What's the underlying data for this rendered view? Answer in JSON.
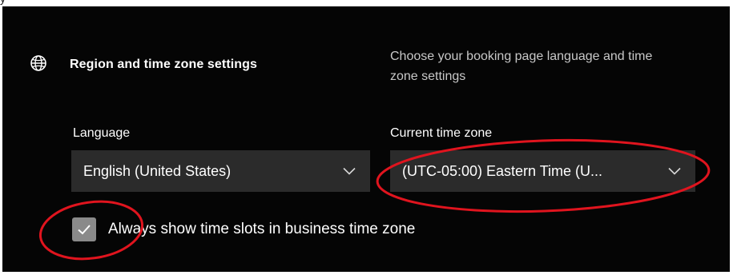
{
  "partial_top_text": "y",
  "section": {
    "icon": "globe-icon",
    "title": "Region and time zone settings",
    "description": "Choose your booking page language and time zone settings"
  },
  "language": {
    "label": "Language",
    "value": "English (United States)",
    "icon": "chevron-down-icon"
  },
  "timezone": {
    "label": "Current time zone",
    "value": "(UTC-05:00) Eastern Time (U...",
    "icon": "chevron-down-icon"
  },
  "business_time_zone": {
    "label": "Always show time slots in business time zone",
    "checked": true,
    "icon": "check-icon"
  },
  "colors": {
    "panel_background": "#050505",
    "dropdown_background": "#2b2b2b",
    "checkbox_fill": "#8a8a8a",
    "annotation_red": "#e0141e"
  }
}
